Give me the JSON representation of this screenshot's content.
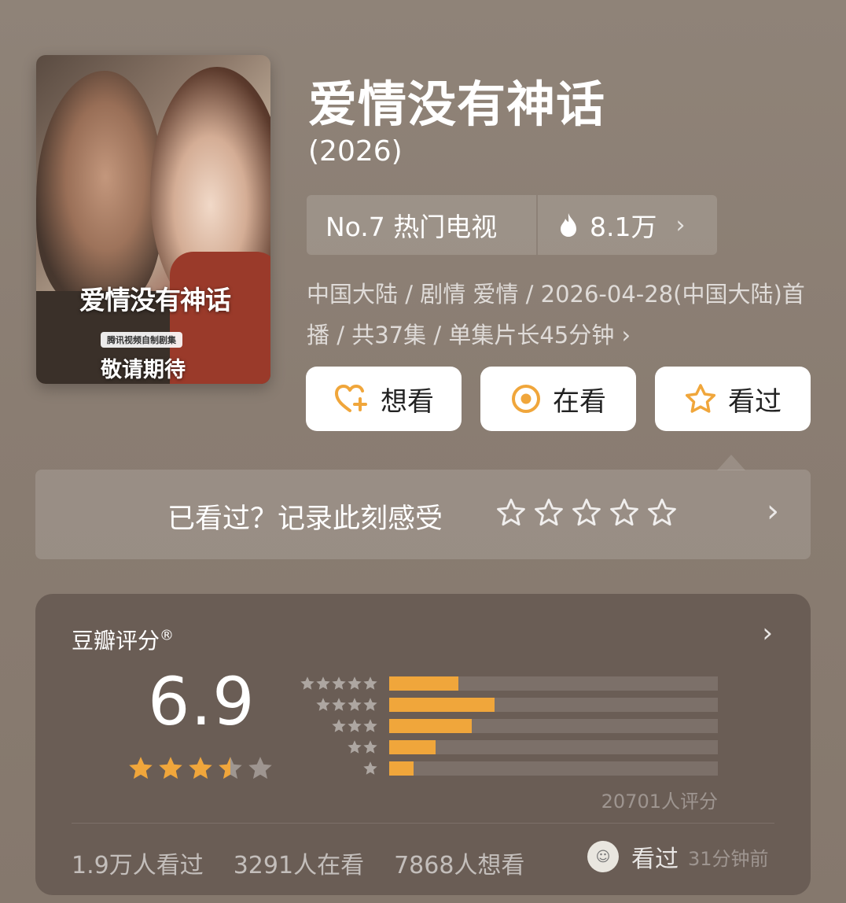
{
  "poster": {
    "title_art": "爱情没有神话",
    "producer": "腾讯视频自制剧集",
    "coming": "敬请期待"
  },
  "title": "爱情没有神话",
  "year": "(2026)",
  "rank": {
    "label": "No.7 热门电视",
    "hot_count": "8.1万"
  },
  "meta_line": "中国大陆 / 剧情 爱情 / 2026-04-28(中国大陆)首播 / 共37集 / 单集片长45分钟",
  "actions": {
    "want": "想看",
    "watching": "在看",
    "watched": "看过"
  },
  "record": {
    "prompt": "已看过？记录此刻感受",
    "stars": 5
  },
  "rating": {
    "label": "豆瓣评分",
    "registered": "®",
    "score": "6.9",
    "stars_value": 3.5,
    "distribution": [
      {
        "stars": 5,
        "fraction": 0.21
      },
      {
        "stars": 4,
        "fraction": 0.32
      },
      {
        "stars": 3,
        "fraction": 0.25
      },
      {
        "stars": 2,
        "fraction": 0.14
      },
      {
        "stars": 1,
        "fraction": 0.075
      }
    ],
    "count_text": "20701人评分"
  },
  "stats": {
    "watched": "1.9万人看过",
    "watching": "3291人在看",
    "want": "7868人想看"
  },
  "friend": {
    "status": "看过",
    "time": "31分钟前"
  },
  "colors": {
    "accent": "#f0a63b",
    "card_bg": "#6a5d55",
    "page_bg": "#8c7f74"
  }
}
